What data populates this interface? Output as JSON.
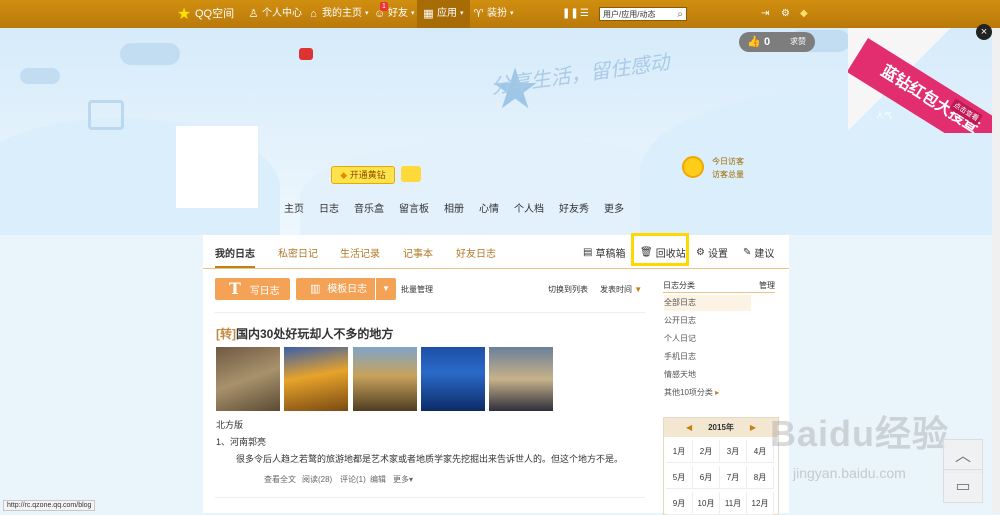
{
  "topbar": {
    "logo": "QQ空间",
    "personal_center": "个人中心",
    "my_home": "我的主页",
    "friends": "好友",
    "friends_badge": "1",
    "apps": "应用",
    "decorate": "装扮",
    "search_placeholder": "用户/应用/动态"
  },
  "banner": {
    "slogan": "分享生活，留住感动",
    "like_count": "0",
    "like_label": "求赞",
    "vip_button": "开通黄钻",
    "visit_today": "今日访客",
    "visit_total": "访客总量",
    "ribbon": "蓝钻红包大搜查",
    "ribbon_tag": "点击查看",
    "ribbon_small": "人气"
  },
  "profile_nav": [
    "主页",
    "日志",
    "音乐盒",
    "留言板",
    "相册",
    "心情",
    "个人档",
    "好友秀",
    "更多"
  ],
  "blog_tabs": [
    "我的日志",
    "私密日记",
    "生活记录",
    "记事本",
    "好友日志"
  ],
  "blog_right": {
    "drafts": "草稿箱",
    "recycle": "回收站",
    "settings": "设置",
    "suggest": "建议"
  },
  "toolbar": {
    "write": "写日志",
    "template": "模板日志",
    "batch": "批量管理",
    "switch_view": "切换到列表",
    "sort": "发表时间"
  },
  "post": {
    "tag": "[转]",
    "title": "国内30处好玩却人不多的地方",
    "section": "北方版",
    "item": "1、河南郭亮",
    "body": "很多令后人趋之若鹜的旅游地都是艺术家或者地质学家先挖掘出来告诉世人的。但这个地方不是。",
    "view_all": "查看全文",
    "read": "阅读(28)",
    "comments": "评论(1)",
    "edit": "编辑",
    "more": "更多"
  },
  "sidebar": {
    "title": "日志分类",
    "manage": "管理",
    "categories": [
      "全部日志",
      "公开日志",
      "个人日记",
      "手机日志",
      "情感天地"
    ],
    "others": "其他10项分类"
  },
  "calendar": {
    "year": "2015年",
    "months": [
      "1月",
      "2月",
      "3月",
      "4月",
      "5月",
      "6月",
      "7月",
      "8月",
      "9月",
      "10月",
      "11月",
      "12月"
    ]
  },
  "status_url": "http://rc.qzone.qq.com/blog",
  "watermark": "Baidu经验",
  "watermark_sub": "jingyan.baidu.com",
  "colors": {
    "topbar": "#c8860a",
    "accent": "#f4a256",
    "highlight": "#ffd800"
  }
}
